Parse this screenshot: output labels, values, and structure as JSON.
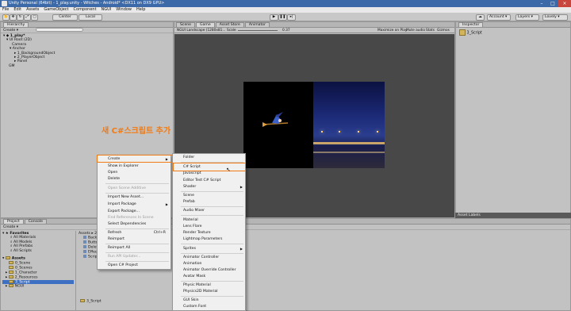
{
  "window": {
    "title": "Unity Personal (64bit) - 1_play.unity - Witches - Android* <DX11 on DX9 GPU>"
  },
  "menu": [
    "File",
    "Edit",
    "Assets",
    "GameObject",
    "Component",
    "NGUI",
    "Window",
    "Help"
  ],
  "toolbar": {
    "pivot_label": "Center",
    "space_label": "Local",
    "account_label": "Account",
    "layers_label": "Layers",
    "layout_label": "Lovely"
  },
  "hierarchy": {
    "title": "Hierarchy",
    "create_label": "Create",
    "items": [
      "1_play*",
      "UI Root (2D)",
      "Camera",
      "Anchor",
      "1_BackgroundObject",
      "2_PlayerObject",
      "Panel",
      "GM"
    ]
  },
  "scene_tabs": {
    "scene": "Scene",
    "game": "Game",
    "asset_store": "Asset Store",
    "animator": "Animator"
  },
  "game_bar": {
    "resolution": "NGUI Landscape (1280x81...",
    "scale_label": "Scale",
    "scale_value": "0.37",
    "maximize": "Maximize on Play",
    "mute": "Mute audio",
    "stats": "Stats",
    "gizmos": "Gizmos"
  },
  "inspector": {
    "title": "Inspector",
    "object_name": "3_Script",
    "asset_labels": "Asset Labels"
  },
  "annotation": {
    "text": "새 C#스크립트 추가",
    "color": "#f07a14"
  },
  "project": {
    "tab_project": "Project",
    "tab_console": "Console",
    "create_label": "Create",
    "favorites_title": "Favorites",
    "favorites": [
      "All Materials",
      "All Models",
      "All Prefabs",
      "All Scripts"
    ],
    "assets_title": "Assets",
    "assets": [
      "0_Scene",
      "0_Scenes",
      "1_Character",
      "2_Resources",
      "3_Script",
      "NGUI"
    ],
    "breadcrumb": "Assets ▸ 2_Res",
    "files": [
      "Backgro",
      "ButtonC",
      "Delete_",
      "Effect_",
      "Script"
    ],
    "status": "3_Script"
  },
  "context_menu": {
    "items": [
      {
        "label": "Create",
        "submenu": true
      },
      {
        "label": "Show in Explorer"
      },
      {
        "label": "Open"
      },
      {
        "label": "Delete"
      },
      {
        "label": "Open Scene Additive",
        "disabled": true
      },
      {
        "label": "Import New Asset..."
      },
      {
        "label": "Import Package",
        "submenu": true
      },
      {
        "label": "Export Package..."
      },
      {
        "label": "Find References In Scene",
        "disabled": true
      },
      {
        "label": "Select Dependencies"
      },
      {
        "label": "Refresh",
        "shortcut": "Ctrl+R"
      },
      {
        "label": "Reimport"
      },
      {
        "label": "Reimport All"
      },
      {
        "label": "Run API Updater...",
        "disabled": true
      },
      {
        "label": "Open C# Project"
      }
    ]
  },
  "create_submenu": {
    "items": [
      {
        "label": "Folder"
      },
      {
        "label": "C# Script"
      },
      {
        "label": "Javascript"
      },
      {
        "label": "Editor Test C# Script"
      },
      {
        "label": "Shader",
        "submenu": true
      },
      {
        "label": "Scene"
      },
      {
        "label": "Prefab"
      },
      {
        "label": "Audio Mixer"
      },
      {
        "label": "Material"
      },
      {
        "label": "Lens Flare"
      },
      {
        "label": "Render Texture"
      },
      {
        "label": "Lightmap Parameters"
      },
      {
        "label": "Sprites",
        "submenu": true
      },
      {
        "label": "Animator Controller"
      },
      {
        "label": "Animation"
      },
      {
        "label": "Animator Override Controller"
      },
      {
        "label": "Avatar Mask"
      },
      {
        "label": "Physic Material"
      },
      {
        "label": "Physics2D Material"
      },
      {
        "label": "GUI Skin"
      },
      {
        "label": "Custom Font"
      }
    ]
  }
}
